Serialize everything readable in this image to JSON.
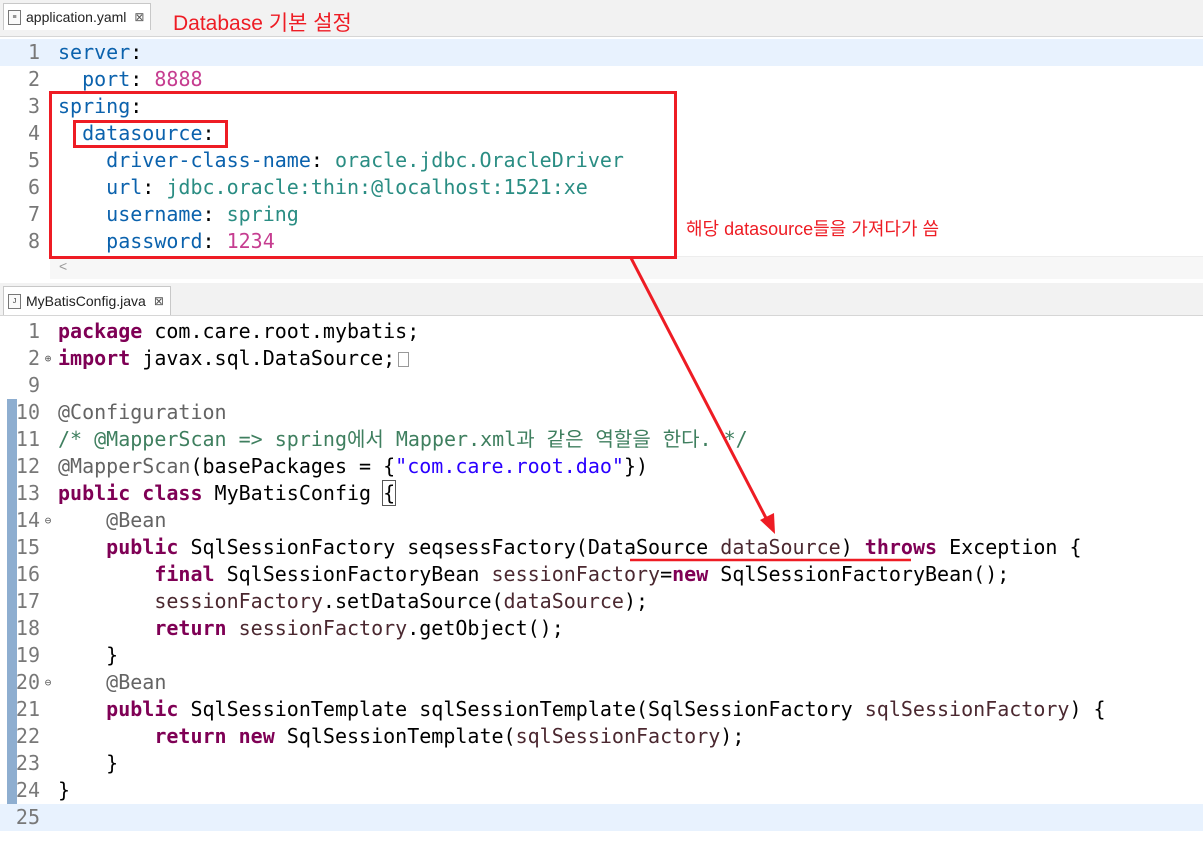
{
  "yaml_tab": {
    "filename": "application.yaml",
    "close_glyph": "⊠"
  },
  "java_tab": {
    "filename": "MyBatisConfig.java",
    "close_glyph": "⊠"
  },
  "annotations": {
    "title_note": "Database 기본 설정",
    "datasource_note": "해당 datasource들을 가져다가 씀"
  },
  "yaml_lines": [
    {
      "num": "1",
      "html": "<span class='k'>server</span>:"
    },
    {
      "num": "2",
      "html": "  <span class='k'>port</span>: <span class='n'>8888</span>"
    },
    {
      "num": "3",
      "html": "<span class='k'>spring</span>:"
    },
    {
      "num": "4",
      "html": "  <span class='k'>datasource</span>:"
    },
    {
      "num": "5",
      "html": "    <span class='k'>driver-class-name</span>: <span class='v'>oracle.jdbc.OracleDriver</span>"
    },
    {
      "num": "6",
      "html": "    <span class='k'>url</span>: <span class='v'>jdbc.oracle:thin:@localhost:1521:xe</span>"
    },
    {
      "num": "7",
      "html": "    <span class='k'>username</span>: <span class='v'>spring</span>"
    },
    {
      "num": "8",
      "html": "    <span class='k'>password</span>: <span class='n'>1234</span>"
    }
  ],
  "scroll_left_glyph": "<",
  "java_lines": [
    {
      "num": "1",
      "html": "<span class='kw'>package</span> com.care.root.mybatis;"
    },
    {
      "num": "2",
      "fold": "⊕",
      "html": "<span class='kw'>import</span> javax.sql.DataSource;<span class='foldbox'></span>"
    },
    {
      "num": "9",
      "html": ""
    },
    {
      "num": "10",
      "html": "<span class='an'>@Configuration</span>"
    },
    {
      "num": "11",
      "html": "<span class='cm'>/* @MapperScan =&gt; spring에서 Mapper.xml과 같은 역할을 한다. */</span>"
    },
    {
      "num": "12",
      "html": "<span class='an'>@MapperScan</span>(basePackages = {<span class='str'>\"com.care.root.dao\"</span>})"
    },
    {
      "num": "13",
      "html": "<span class='kw'>public</span> <span class='kw'>class</span> MyBatisConfig <span style='outline:1px solid #555'>{</span>"
    },
    {
      "num": "14",
      "fold": "⊖",
      "html": "    <span class='an'>@Bean</span>"
    },
    {
      "num": "15",
      "html": "    <span class='kw'>public</span> SqlSessionFactory seqsessFactory(DataSource <span class='f'>dataSource</span>) <span class='kw'>throws</span> Exception {"
    },
    {
      "num": "16",
      "html": "        <span class='kw'>final</span> SqlSessionFactoryBean <span class='f'>sessionFactory</span>=<span class='kw'>new</span> SqlSessionFactoryBean();"
    },
    {
      "num": "17",
      "html": "        <span class='f'>sessionFactory</span>.setDataSource(<span class='f'>dataSource</span>);"
    },
    {
      "num": "18",
      "html": "        <span class='kw'>return</span> <span class='f'>sessionFactory</span>.getObject();"
    },
    {
      "num": "19",
      "html": "    }"
    },
    {
      "num": "20",
      "fold": "⊖",
      "html": "    <span class='an'>@Bean</span>"
    },
    {
      "num": "21",
      "html": "    <span class='kw'>public</span> SqlSessionTemplate sqlSessionTemplate(SqlSessionFactory <span class='f'>sqlSessionFactory</span>) {"
    },
    {
      "num": "22",
      "html": "        <span class='kw'>return</span> <span class='kw'>new</span> SqlSessionTemplate(<span class='f'>sqlSessionFactory</span>);"
    },
    {
      "num": "23",
      "html": "    }"
    },
    {
      "num": "24",
      "html": "}"
    },
    {
      "num": "25",
      "html": ""
    }
  ],
  "colors": {
    "annotation_red": "#ee1c24",
    "current_line": "#e8f2fe"
  }
}
